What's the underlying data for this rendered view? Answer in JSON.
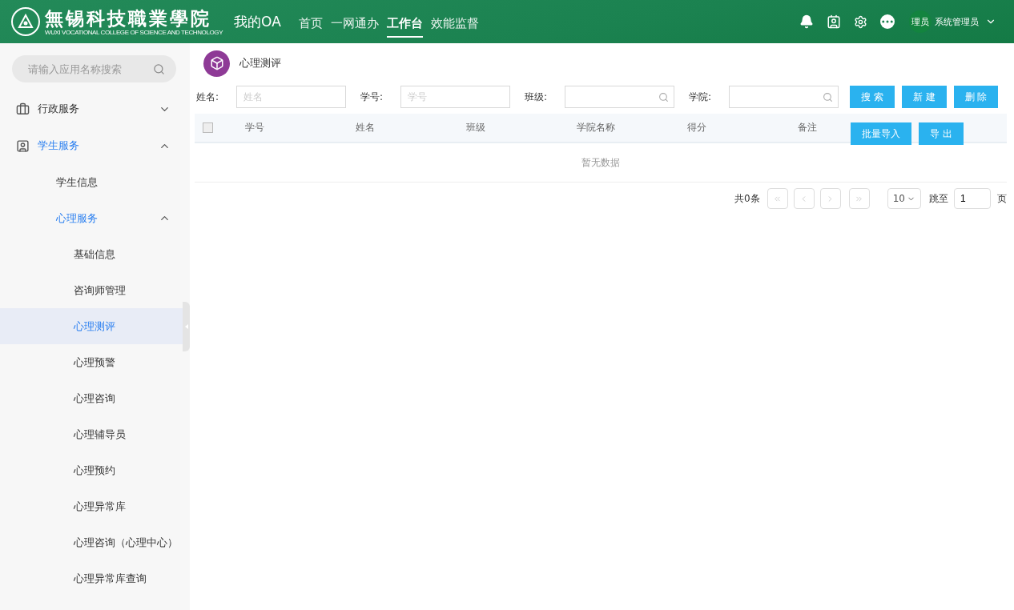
{
  "header": {
    "logo_title": "無锡科技職業學院",
    "logo_subtitle": "WUXI VOCATIONAL COLLEGE OF SCIENCE AND TECHNOLOGY",
    "app_name": "我的OA",
    "nav": [
      {
        "label": "首页",
        "selected": false
      },
      {
        "label": "一网通办",
        "selected": false
      },
      {
        "label": "工作台",
        "selected": true
      },
      {
        "label": "效能监督",
        "selected": false
      }
    ],
    "avatar_text": "理员",
    "user_name": "系统管理员"
  },
  "sidebar": {
    "search": {
      "placeholder": "请输入应用名称搜索"
    },
    "items": [
      {
        "label": "行政服务",
        "expanded": false,
        "selected": false
      },
      {
        "label": "学生服务",
        "expanded": true,
        "selected": true,
        "children": [
          {
            "label": "学生信息",
            "selected": false
          },
          {
            "label": "心理服务",
            "expanded": true,
            "selected": true,
            "children": [
              {
                "label": "基础信息",
                "selected": false
              },
              {
                "label": "咨询师管理",
                "selected": false
              },
              {
                "label": "心理测评",
                "selected": true
              },
              {
                "label": "心理预警",
                "selected": false
              },
              {
                "label": "心理咨询",
                "selected": false
              },
              {
                "label": "心理辅导员",
                "selected": false
              },
              {
                "label": "心理预约",
                "selected": false
              },
              {
                "label": "心理异常库",
                "selected": false
              },
              {
                "label": "心理咨询（心理中心）",
                "selected": false
              },
              {
                "label": "心理异常库查询",
                "selected": false
              }
            ]
          }
        ]
      }
    ]
  },
  "page": {
    "title": "心理测评",
    "filters": [
      {
        "label": "姓名:",
        "placeholder": "姓名",
        "kind": "text"
      },
      {
        "label": "学号:",
        "placeholder": "学号",
        "kind": "text"
      },
      {
        "label": "班级:",
        "kind": "search"
      },
      {
        "label": "学院:",
        "kind": "search"
      }
    ],
    "buttons": [
      "搜 索",
      "新 建",
      "删 除"
    ],
    "extra_buttons": [
      "批量导入",
      "导 出"
    ],
    "table": {
      "select_all_checked": false,
      "columns": [
        "学号",
        "姓名",
        "班级",
        "学院名称",
        "得分",
        "备注"
      ],
      "empty_text": "暂无数据"
    },
    "pagination": {
      "total": "共0条",
      "page_size": "10",
      "jump_label": "跳至",
      "page_value": "1",
      "page_suffix": "页"
    }
  }
}
